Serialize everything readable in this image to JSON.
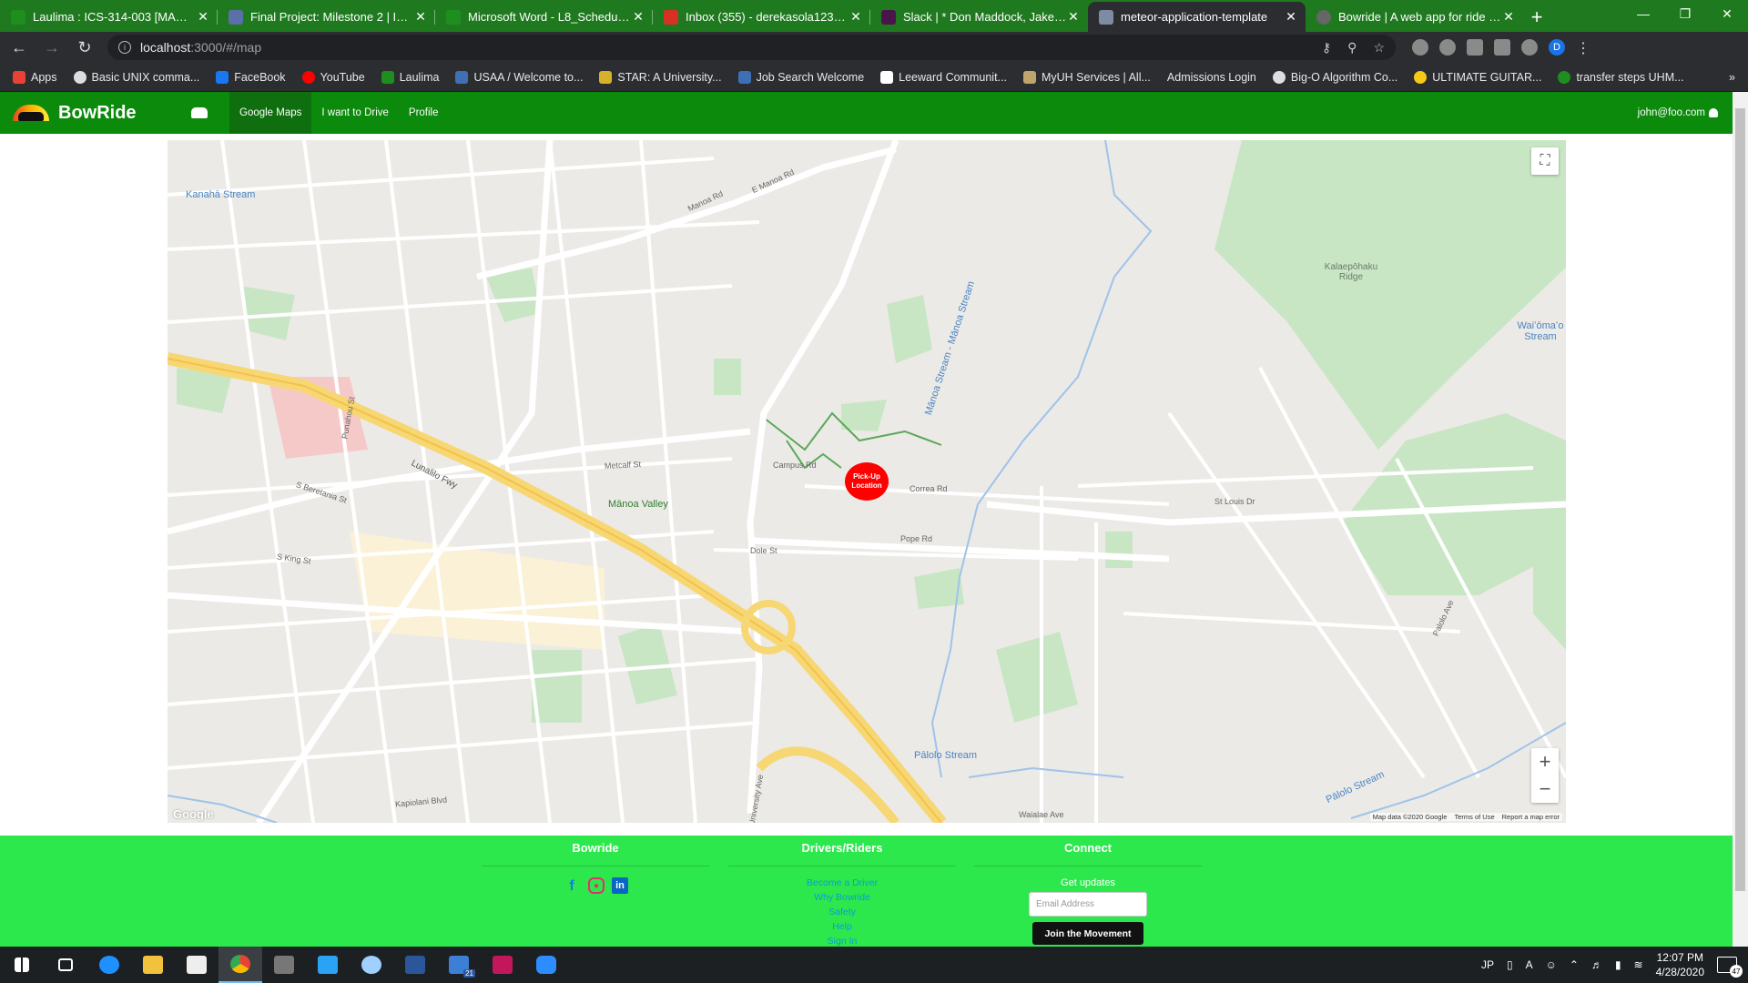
{
  "browser": {
    "tabs": [
      {
        "title": "Laulima : ICS-314-003 [MAN.871",
        "favicon_color": "#1e8e1e",
        "active": false
      },
      {
        "title": "Final Project: Milestone 2 | ICS 31",
        "favicon_color": "#5b6fa8",
        "active": false
      },
      {
        "title": "Microsoft Word - L8_Schedule(S2",
        "favicon_color": "#1e8e1e",
        "active": false
      },
      {
        "title": "Inbox (355) - derekasola123@gm",
        "favicon_color": "#d93025",
        "active": false
      },
      {
        "title": "Slack | * Don Maddock, Jake Hijin",
        "favicon_color": "#4a154b",
        "active": false
      },
      {
        "title": "meteor-application-template",
        "favicon_color": "#7d8ca3",
        "active": true
      },
      {
        "title": "Bowride | A web app for ride sha",
        "favicon_color": "#666666",
        "active": false
      }
    ],
    "url_host": "localhost",
    "url_rest": ":3000/#/map",
    "profile_initial": "D",
    "bookmarks": [
      {
        "label": "Apps",
        "color": "#e94235"
      },
      {
        "label": "Basic UNIX comma...",
        "color": "#dddddd"
      },
      {
        "label": "FaceBook",
        "color": "#1877f2"
      },
      {
        "label": "YouTube",
        "color": "#ff0000"
      },
      {
        "label": "Laulima",
        "color": "#1e8e1e"
      },
      {
        "label": "USAA / Welcome to...",
        "color": "#3f6fb5"
      },
      {
        "label": "STAR: A University...",
        "color": "#d8b12c"
      },
      {
        "label": "Job Search Welcome",
        "color": "#3f6fb5"
      },
      {
        "label": "Leeward Communit...",
        "color": "#ffffff"
      },
      {
        "label": "MyUH Services | All...",
        "color": "#bfa46b"
      },
      {
        "label": "Admissions Login",
        "color": "#2b2d30"
      },
      {
        "label": "Big-O Algorithm Co...",
        "color": "#dddddd"
      },
      {
        "label": "ULTIMATE GUITAR...",
        "color": "#f6c915"
      },
      {
        "label": "transfer steps UHM...",
        "color": "#1e8e1e"
      }
    ]
  },
  "app": {
    "brand": "BowRide",
    "nav": [
      {
        "label": "Google Maps",
        "active": true
      },
      {
        "label": "I want to Drive",
        "active": false
      },
      {
        "label": "Profile",
        "active": false
      }
    ],
    "user": "john@foo.com"
  },
  "map": {
    "pin_label": "Pick-Up Location",
    "labels": {
      "kanaha": "Kanahā Stream",
      "waiomao": "Waiʻōmaʻo Stream",
      "kalaepohaku": "Kalaepōhaku Ridge",
      "manoa_valley": "Mānoa Valley",
      "palolo_stream": "Pālolo Stream",
      "manoa_stream": "Mānoa Stream - Mānoa Stream",
      "palolo_stream2": "Pālolo Stream",
      "lunalilo": "Lunalilo Fwy",
      "manoa_rd": "Manoa Rd",
      "e_manoa_rd": "E Manoa Rd",
      "metcalf": "Metcalf St",
      "s_beretania": "S Beretania St",
      "s_king": "S King St",
      "university": "University Ave",
      "dole": "Dole St",
      "kapiolani": "Kapiolani Blvd",
      "waialae": "Waialae Ave",
      "st_louis": "St Louis Dr",
      "palolo_ave": "Palolo Ave",
      "campus_rd": "Campus Rd",
      "correa": "Correa Rd",
      "pope": "Pope Rd",
      "punahou": "Punahou St"
    },
    "attribution": [
      "Map data ©2020 Google",
      "Terms of Use",
      "Report a map error"
    ],
    "google_logo": "Google"
  },
  "footer": {
    "col1_title": "Bowride",
    "col2_title": "Drivers/Riders",
    "col2_links": [
      "Become a Driver",
      "Why Bowride",
      "Safety",
      "Help",
      "Sign In"
    ],
    "col3_title": "Connect",
    "get_updates": "Get updates",
    "email_placeholder": "Email Address",
    "join_button": "Join the Movement"
  },
  "taskbar": {
    "time": "12:07 PM",
    "date": "4/28/2020",
    "lang": "JP",
    "notif_count": "47",
    "mail_badge": "21"
  }
}
